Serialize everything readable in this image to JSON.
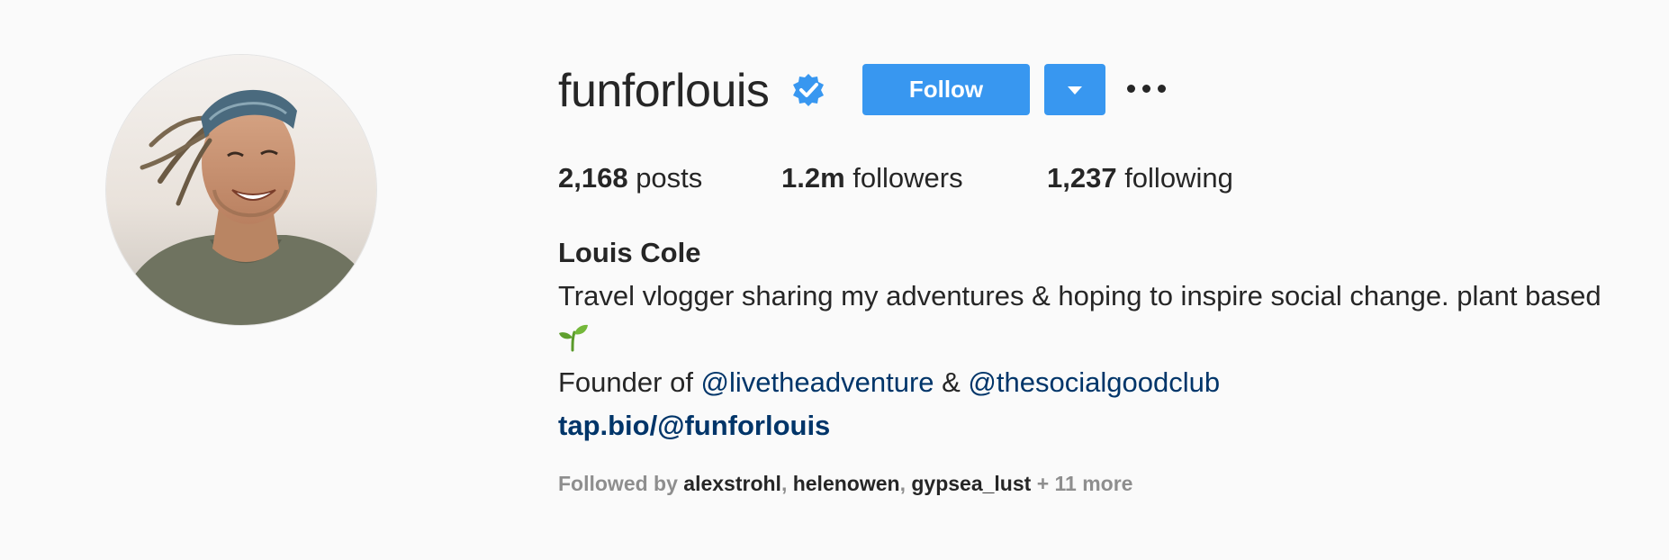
{
  "profile": {
    "username": "funforlouis",
    "verified": true,
    "full_name": "Louis Cole",
    "bio_line1": "Travel vlogger sharing my adventures & hoping to inspire social change. plant based",
    "bio_emoji": "seedling",
    "founder_prefix": "Founder of ",
    "mention1": "@livetheadventure",
    "ampersand": " & ",
    "mention2": "@thesocialgoodclub",
    "website": "tap.bio/@funforlouis"
  },
  "actions": {
    "follow_label": "Follow",
    "dropdown_icon": "caret-down-icon",
    "more_icon": "ellipsis-icon"
  },
  "stats": {
    "posts_count": "2,168",
    "posts_label": " posts",
    "followers_count": "1.2m",
    "followers_label": " followers",
    "following_count": "1,237",
    "following_label": " following"
  },
  "followed_by": {
    "prefix": "Followed by ",
    "user1": "alexstrohl",
    "sep1": ", ",
    "user2": "helenowen",
    "sep2": ", ",
    "user3": "gypsea_lust",
    "more": " + 11 more"
  },
  "colors": {
    "accent": "#3897f0",
    "link": "#003569",
    "text": "#262626",
    "muted": "#8e8e8e",
    "background": "#fafafa"
  }
}
